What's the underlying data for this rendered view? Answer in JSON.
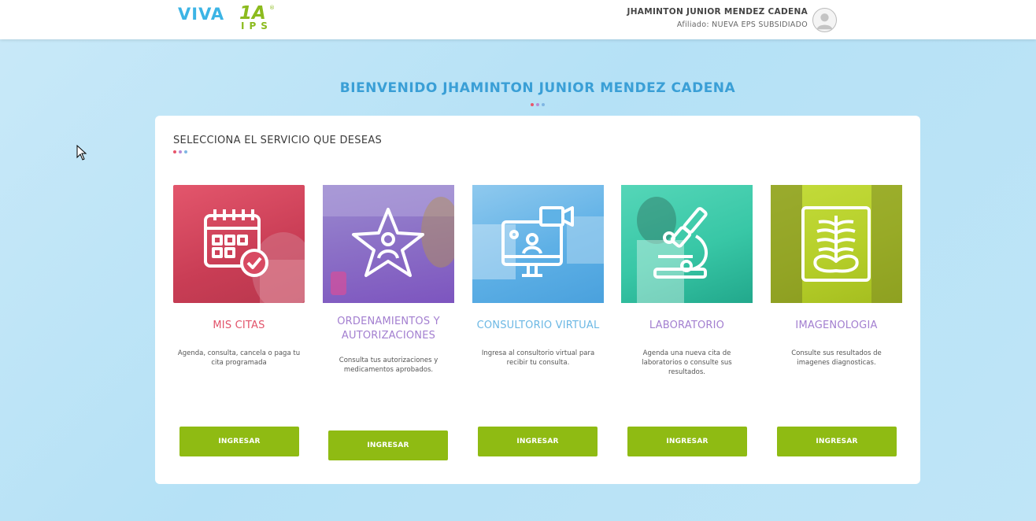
{
  "header": {
    "logo_main": "VIVA",
    "logo_num": "1A",
    "logo_sub": "IPS",
    "logo_reg": "®",
    "user_name": "JHAMINTON JUNIOR MENDEZ CADENA",
    "user_affiliation": "Afiliado: NUEVA EPS SUBSIDIADO"
  },
  "welcome": "BIENVENIDO JHAMINTON JUNIOR MENDEZ CADENA",
  "panel": {
    "title": "SELECCIONA EL SERVICIO QUE DESEAS"
  },
  "services": [
    {
      "title": "MIS CITAS",
      "description": "Agenda, consulta, cancela o paga tu cita programada",
      "button": "INGRESAR",
      "icon": "calendar-check-icon",
      "color": "#e2536a"
    },
    {
      "title": "ORDENAMIENTOS Y AUTORIZACIONES",
      "description": "Consulta tus autorizaciones y medicamentos aprobados.",
      "button": "INGRESAR",
      "icon": "star-person-icon",
      "color": "#a37fd0"
    },
    {
      "title": "CONSULTORIO VIRTUAL",
      "description": "Ingresa al consultorio virtual para recibir tu consulta.",
      "button": "INGRESAR",
      "icon": "video-monitor-icon",
      "color": "#6cb8e4"
    },
    {
      "title": "LABORATORIO",
      "description": "Agenda una nueva cita de laboratorios o consulte sus resultados.",
      "button": "INGRESAR",
      "icon": "microscope-icon",
      "color": "#a37fd0"
    },
    {
      "title": "IMAGENOLOGIA",
      "description": "Consulte sus resultados de imagenes diagnosticas.",
      "button": "INGRESAR",
      "icon": "xray-icon",
      "color": "#a37fd0"
    }
  ]
}
